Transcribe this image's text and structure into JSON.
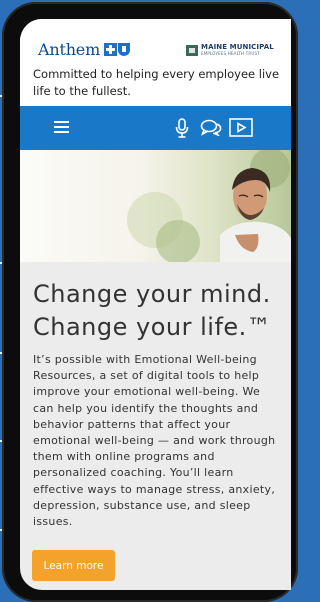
{
  "header": {
    "brand": "Anthem",
    "partner_name": "MAINE MUNICIPAL",
    "partner_subtitle": "EMPLOYEES HEALTH TRUST",
    "tagline": "Committed to helping every employee live life to the fullest."
  },
  "nav": {
    "icons": [
      "menu-icon",
      "microphone-icon",
      "chat-icon",
      "video-icon"
    ]
  },
  "main": {
    "headline_line1": "Change your mind.",
    "headline_line2": "Change your life.™",
    "body": "It’s possible with Emotional Well-being Resources, a set of digital tools to help improve your emotional well-being. We can help you identify the thoughts and behavior patterns that affect your emotional well-being — and work through them with online programs and personalized coaching. You’ll learn effective ways to manage stress, anxiety, depression, substance use, and sleep issues.",
    "cta_label": "Learn more"
  },
  "colors": {
    "nav_blue": "#1a78c8",
    "cta_orange": "#f3a22b",
    "page_bg": "#ececec"
  }
}
